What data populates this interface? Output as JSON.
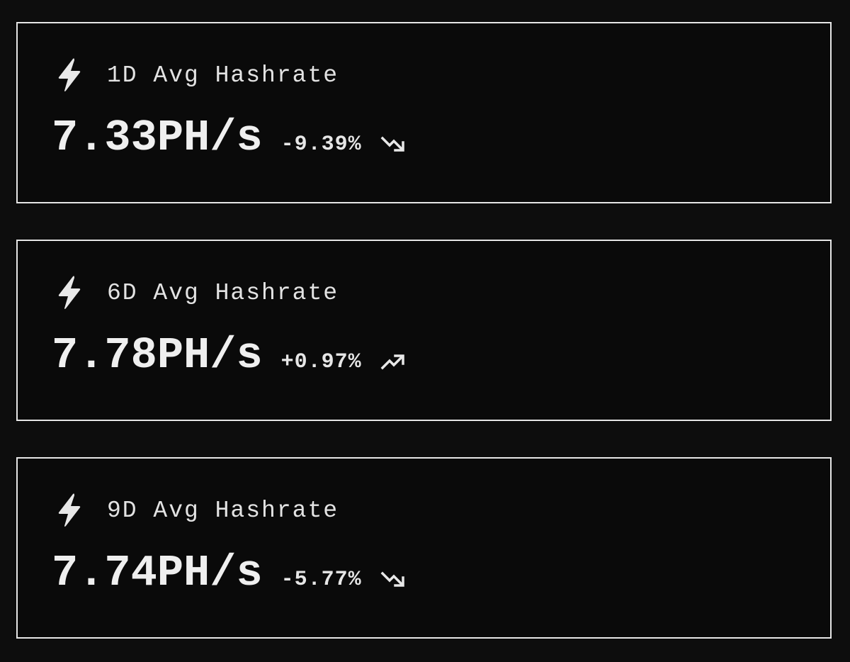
{
  "cards": [
    {
      "label": "1D Avg Hashrate",
      "value": "7.33PH/s",
      "change": "-9.39%",
      "trend": "down",
      "icon": "lightning-bolt-icon"
    },
    {
      "label": "6D Avg Hashrate",
      "value": "7.78PH/s",
      "change": "+0.97%",
      "trend": "up",
      "icon": "lightning-bolt-icon"
    },
    {
      "label": "9D Avg Hashrate",
      "value": "7.74PH/s",
      "change": "-5.77%",
      "trend": "down",
      "icon": "lightning-bolt-icon"
    }
  ],
  "colors": {
    "background": "#0d0d0d",
    "border": "#e6e6e6",
    "text": "#e8e8e8"
  }
}
